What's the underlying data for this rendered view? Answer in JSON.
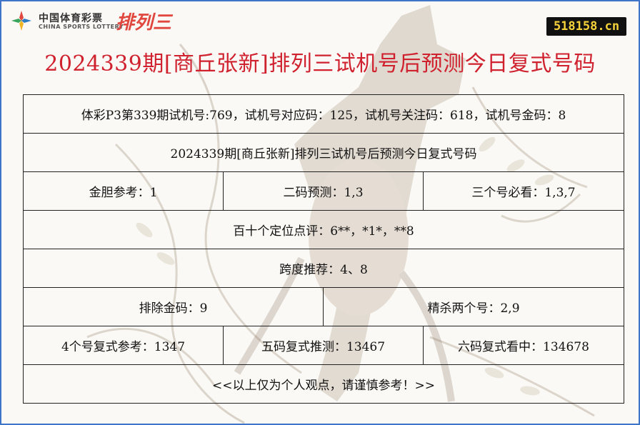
{
  "logo": {
    "cn": "中国体育彩票",
    "en": "CHINA SPORTS LOTTERY",
    "p3": "排列三"
  },
  "site_badge": "518158.cn",
  "title": "2024339期[商丘张新]排列三试机号后预测今日复式号码",
  "rows": {
    "trial_info": "体彩P3第339期试机号:769，试机号对应码：125，试机号关注码：618，试机号金码：8",
    "subtitle": "2024339期[商丘张新]排列三试机号后预测今日复式号码",
    "gold_label": "金胆参考：",
    "gold_value": "1",
    "two_code_label": "二码预测：",
    "two_code_value": "1,3",
    "three_must_label": "三个号必看：",
    "three_must_value": "1,3,7",
    "position_label": "百十个定位点评：",
    "position_value": "6**，*1*，**8",
    "span_label": "跨度推荐：",
    "span_value": "4、8",
    "exclude_label": "排除金码：",
    "exclude_value": "9",
    "kill_label": "精杀两个号：",
    "kill_value": "2,9",
    "four_label": "4个号复式参考：",
    "four_value": "1347",
    "five_label": "五码复式推测：",
    "five_value": "13467",
    "six_label": "六码复式看中：",
    "six_value": "134678",
    "disclaimer": "<<以上仅为个人观点，请谨慎参考！>>"
  },
  "colors": {
    "title_red": "#d0212e",
    "border_blue": "#3f74c9",
    "badge_bg": "#111111",
    "badge_text": "#f5d23a"
  }
}
